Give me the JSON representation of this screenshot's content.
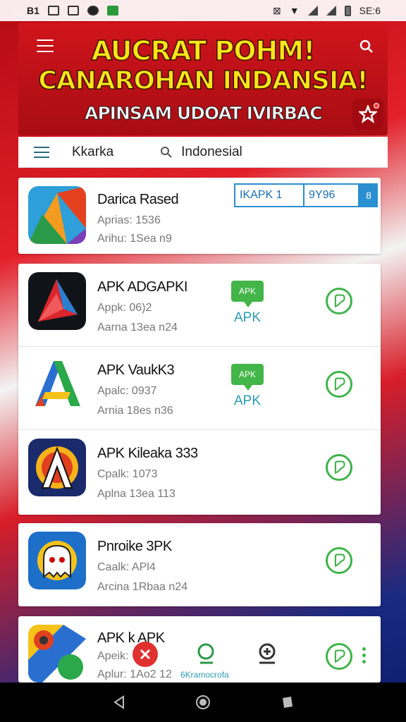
{
  "status_bar": {
    "left_text": "B1",
    "time": "SE:6"
  },
  "header": {
    "banner_line1": "AUCRAT POHM!",
    "banner_line2": "CANAROHAN INDANSIA!",
    "banner_subtitle": "APINSAM UDOAT IVIRBAC",
    "colors": {
      "banner_bg": "#c8121b",
      "banner_text": "#f7e419"
    }
  },
  "search_bar": {
    "location_label": "Kkarka",
    "search_value": "Indonesial"
  },
  "featured": {
    "name": "Darica Rased",
    "meta1": "Aprias: 1536",
    "meta2": "Arihu: 1Sea n9",
    "box_label": "IKAPK 1",
    "box_value": "9Y96",
    "box_button": "8"
  },
  "apps": [
    {
      "name": "APK ADGAPKI",
      "meta1": "Appk: 06)2",
      "meta2": "Aarna 13ea n24",
      "bubble": "APK",
      "badge_label": "APK",
      "icon": "red-arrow-icon"
    },
    {
      "name": "APK VaukK3",
      "meta1": "Apalc: 0937",
      "meta2": "Arnia 18es n36",
      "bubble": "APK",
      "badge_label": "APK",
      "icon": "letter-a-icon"
    },
    {
      "name": "APK Kileaka 333",
      "meta1": "Cpalk: 1073",
      "meta2": "Aplna 13ea 113",
      "icon": "sunburst-a-icon"
    },
    {
      "name": "Pnroike 3PK",
      "meta1": "Caalk: APl4",
      "meta2": "Arcina 1Rbaa n24",
      "icon": "ghost-icon"
    },
    {
      "name": "APK k APK",
      "meta1": "Apeik:",
      "meta2": "Aplur: 1Ao2 12",
      "icon": "maps-pin-icon"
    }
  ],
  "bottom_actions": {
    "search_label": "6Kramocrofa"
  }
}
